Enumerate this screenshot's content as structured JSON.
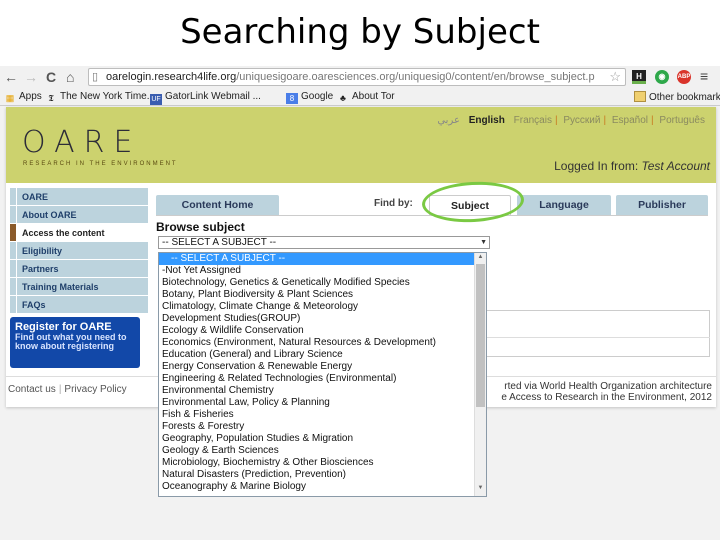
{
  "slide": {
    "title": "Searching by Subject"
  },
  "browser": {
    "nav": {
      "back": "←",
      "forward": "→",
      "reload": "C",
      "home": "⌂"
    },
    "url": {
      "host": "oarelogin.research4life.org",
      "path": "/uniquesigoare.oaresciences.org/uniquesig0/content/en/browse_subject.p"
    },
    "bookmarks": [
      {
        "label": "Apps",
        "icon": "▦"
      },
      {
        "label": "The New York Time...",
        "icon": "𝕿"
      },
      {
        "label": "GatorLink Webmail ...",
        "icon": "UF"
      },
      {
        "label": "Google",
        "icon": "8"
      },
      {
        "label": "About Tor",
        "icon": "♣"
      },
      {
        "label": "Other bookmarks",
        "icon": ""
      }
    ],
    "extensions": {
      "h": "H",
      "ghostery": "◉",
      "abp": "ABP",
      "menu": "≡"
    }
  },
  "site": {
    "logo": "OARE",
    "tagline": "RESEARCH IN THE ENVIRONMENT",
    "languages": {
      "prefix": "عربي",
      "items": [
        "English",
        "Français",
        "Русский",
        "Español",
        "Português"
      ],
      "active": "English"
    },
    "logged_in_label": "Logged In from:",
    "account": "Test Account",
    "sidebar": [
      "OARE",
      "About OARE",
      "Access the content",
      "Eligibility",
      "Partners",
      "Training Materials",
      "FAQs"
    ],
    "sidebar_active": "Access the content",
    "register": {
      "title": "Register for OARE",
      "desc": "Find out what you need to know about registering"
    },
    "footer_links": [
      "Contact us",
      "Privacy Policy"
    ],
    "credit_lines": [
      "rted via World Health Organization architecture",
      "e Access to Research in the Environment, 2012"
    ]
  },
  "content": {
    "tabs": {
      "home": "Content Home",
      "find_by": "Find by:",
      "subject": "Subject",
      "language": "Language",
      "publisher": "Publisher"
    },
    "browse_label": "Browse subject",
    "select_value": "-- SELECT A SUBJECT --",
    "options": [
      "-- SELECT A SUBJECT --",
      "-Not Yet Assigned",
      "Biotechnology, Genetics & Genetically Modified Species",
      "Botany, Plant Biodiversity & Plant Sciences",
      "Climatology, Climate Change & Meteorology",
      "Development Studies(GROUP)",
      "Ecology & Wildlife Conservation",
      "Economics (Environment, Natural Resources & Development)",
      "Education (General) and Library Science",
      "Energy Conservation & Renewable Energy",
      "Engineering & Related Technologies (Environmental)",
      "Environmental Chemistry",
      "Environmental Law, Policy & Planning",
      "Fish & Fisheries",
      "Forests & Forestry",
      "Geography, Population Studies & Migration",
      "Geology & Earth Sciences",
      "Microbiology, Biochemistry & Other Biosciences",
      "Natural Disasters (Prediction, Prevention)",
      "Oceanography & Marine Biology"
    ]
  }
}
